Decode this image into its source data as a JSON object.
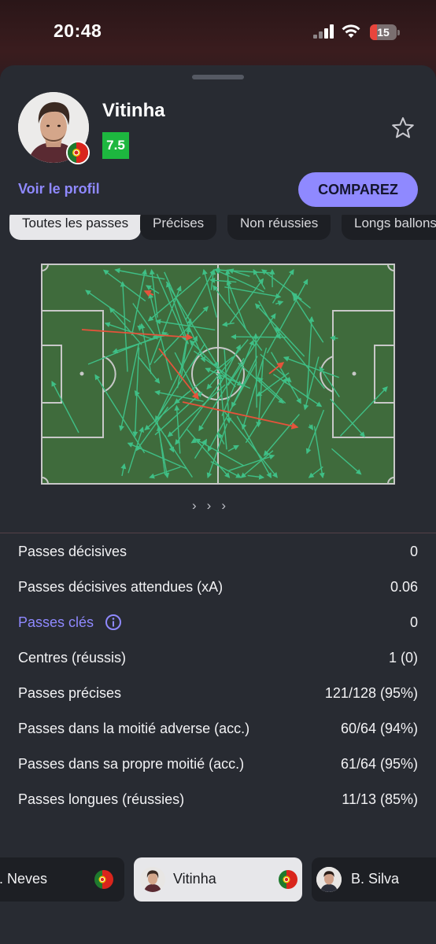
{
  "status_bar": {
    "time": "20:48",
    "battery": "15",
    "battery_fraction": 0.15
  },
  "player": {
    "name": "Vitinha",
    "rating": "7.5",
    "rating_color": "#1db73f",
    "nationality_flag": "portugal-flag"
  },
  "actions": {
    "profile_link": "Voir le profil",
    "compare_button": "COMPAREZ"
  },
  "filters": [
    {
      "label": "Toutes les passes",
      "active": true
    },
    {
      "label": "Précises",
      "active": false
    },
    {
      "label": "Non réussies",
      "active": false
    },
    {
      "label": "Longs ballons",
      "active": false
    }
  ],
  "pass_map": {
    "pitch_color": "#3f6b3c",
    "line_color": "#c8c8c8",
    "success_color": "#3fbf86",
    "fail_color": "#e5533b"
  },
  "pager": {
    "icon": "chevron-right-triple-icon",
    "glyphs": "›››"
  },
  "stats": [
    {
      "label": "Passes décisives",
      "value": "0",
      "link": false
    },
    {
      "label": "Passes décisives attendues (xA)",
      "value": "0.06",
      "link": false
    },
    {
      "label": "Passes clés",
      "value": "0",
      "link": true,
      "icon": "info-icon"
    },
    {
      "label": "Centres (réussis)",
      "value": "1 (0)",
      "link": false
    },
    {
      "label": "Passes précises",
      "value": "121/128 (95%)",
      "link": false
    },
    {
      "label": "Passes dans la moitié adverse (acc.)",
      "value": "60/64 (94%)",
      "link": false
    },
    {
      "label": "Passes dans sa propre moitié (acc.)",
      "value": "61/64 (95%)",
      "link": false
    },
    {
      "label": "Passes longues (réussies)",
      "value": "11/13 (85%)",
      "link": false
    }
  ],
  "players_carousel": [
    {
      "name": "J. Neves",
      "selected": false
    },
    {
      "name": "Vitinha",
      "selected": true
    },
    {
      "name": "B. Silva",
      "selected": false
    }
  ],
  "colors": {
    "accent": "#8f89ff",
    "sheet_bg": "#282b32",
    "page_bg": "#1a1416"
  }
}
